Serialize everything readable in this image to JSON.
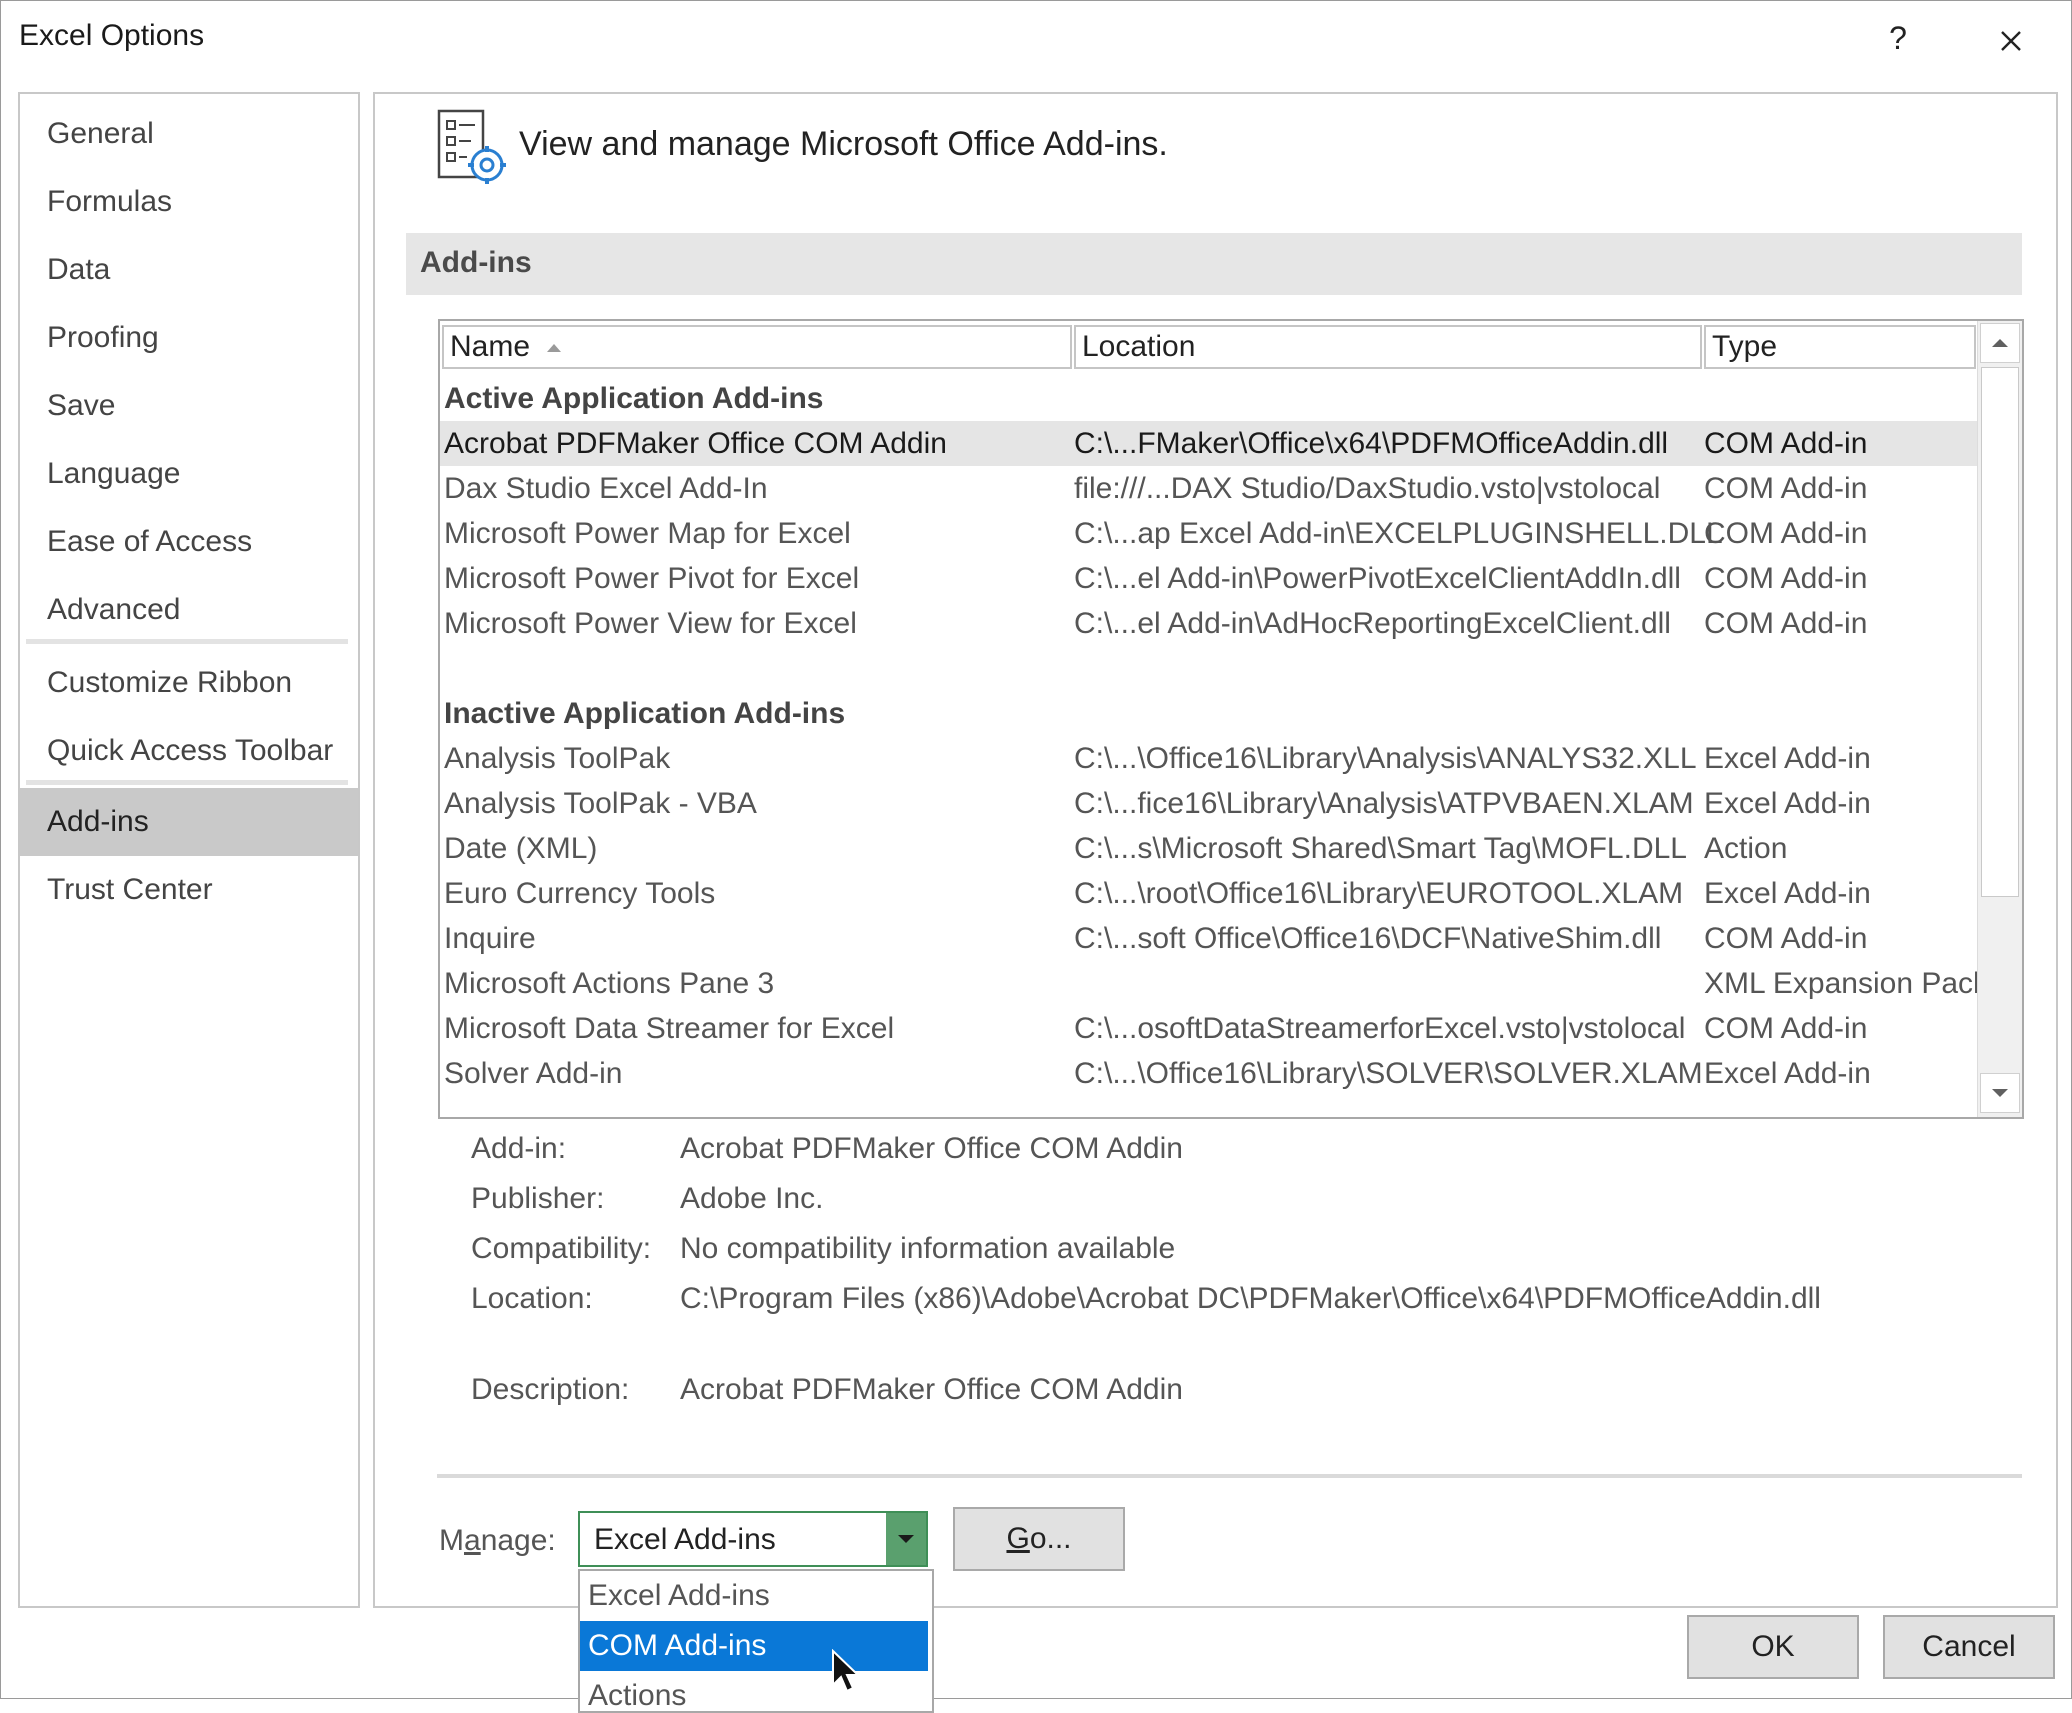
{
  "window": {
    "title": "Excel Options",
    "help_glyph": "?",
    "close_glyph": "✕"
  },
  "nav": {
    "items": [
      "General",
      "Formulas",
      "Data",
      "Proofing",
      "Save",
      "Language",
      "Ease of Access",
      "Advanced",
      "Customize Ribbon",
      "Quick Access Toolbar",
      "Add-ins",
      "Trust Center"
    ],
    "selected": "Add-ins"
  },
  "header": {
    "text": "View and manage Microsoft Office Add-ins.",
    "icon": "addins-settings-icon"
  },
  "section": {
    "title": "Add-ins"
  },
  "table": {
    "columns": [
      "Name",
      "Location",
      "Type"
    ],
    "sort_column": "Name",
    "groups": [
      {
        "title": "Active Application Add-ins",
        "rows": [
          [
            "Acrobat PDFMaker Office COM Addin",
            "C:\\...FMaker\\Office\\x64\\PDFMOfficeAddin.dll",
            "COM Add-in"
          ],
          [
            "Dax Studio Excel Add-In",
            "file:///...DAX Studio/DaxStudio.vsto|vstolocal",
            "COM Add-in"
          ],
          [
            "Microsoft Power Map for Excel",
            "C:\\...ap Excel Add-in\\EXCELPLUGINSHELL.DLL",
            "COM Add-in"
          ],
          [
            "Microsoft Power Pivot for Excel",
            "C:\\...el Add-in\\PowerPivotExcelClientAddIn.dll",
            "COM Add-in"
          ],
          [
            "Microsoft Power View for Excel",
            "C:\\...el Add-in\\AdHocReportingExcelClient.dll",
            "COM Add-in"
          ]
        ]
      },
      {
        "title": "Inactive Application Add-ins",
        "rows": [
          [
            "Analysis ToolPak",
            "C:\\...\\Office16\\Library\\Analysis\\ANALYS32.XLL",
            "Excel Add-in"
          ],
          [
            "Analysis ToolPak - VBA",
            "C:\\...fice16\\Library\\Analysis\\ATPVBAEN.XLAM",
            "Excel Add-in"
          ],
          [
            "Date (XML)",
            "C:\\...s\\Microsoft Shared\\Smart Tag\\MOFL.DLL",
            "Action"
          ],
          [
            "Euro Currency Tools",
            "C:\\...\\root\\Office16\\Library\\EUROTOOL.XLAM",
            "Excel Add-in"
          ],
          [
            "Inquire",
            "C:\\...soft Office\\Office16\\DCF\\NativeShim.dll",
            "COM Add-in"
          ],
          [
            "Microsoft Actions Pane 3",
            "",
            "XML Expansion Pack"
          ],
          [
            "Microsoft Data Streamer for Excel",
            "C:\\...osoftDataStreamerforExcel.vsto|vstolocal",
            "COM Add-in"
          ],
          [
            "Solver Add-in",
            "C:\\...\\Office16\\Library\\SOLVER\\SOLVER.XLAM",
            "Excel Add-in"
          ]
        ]
      }
    ],
    "selected_row": "Acrobat PDFMaker Office COM Addin"
  },
  "details": {
    "addin_label": "Add-in:",
    "addin": "Acrobat PDFMaker Office COM Addin",
    "publisher_label": "Publisher:",
    "publisher": "Adobe Inc.",
    "compat_label": "Compatibility:",
    "compat": "No compatibility information available",
    "location_label": "Location:",
    "location": "C:\\Program Files (x86)\\Adobe\\Acrobat DC\\PDFMaker\\Office\\x64\\PDFMOfficeAddin.dll",
    "desc_label": "Description:",
    "desc": "Acrobat PDFMaker Office COM Addin"
  },
  "manage": {
    "label_pre": "M",
    "label_underlined": "a",
    "label_post": "nage:",
    "value": "Excel Add-ins",
    "options": [
      "Excel Add-ins",
      "COM Add-ins",
      "Actions"
    ],
    "highlighted": "COM Add-ins",
    "go_underlined": "G",
    "go_rest": "o..."
  },
  "buttons": {
    "ok": "OK",
    "cancel": "Cancel"
  },
  "colors": {
    "accent": "#0a78d7",
    "combo_border": "#3f8f57",
    "combo_button": "#5aa06e",
    "selected_nav": "#c9c9c9"
  }
}
